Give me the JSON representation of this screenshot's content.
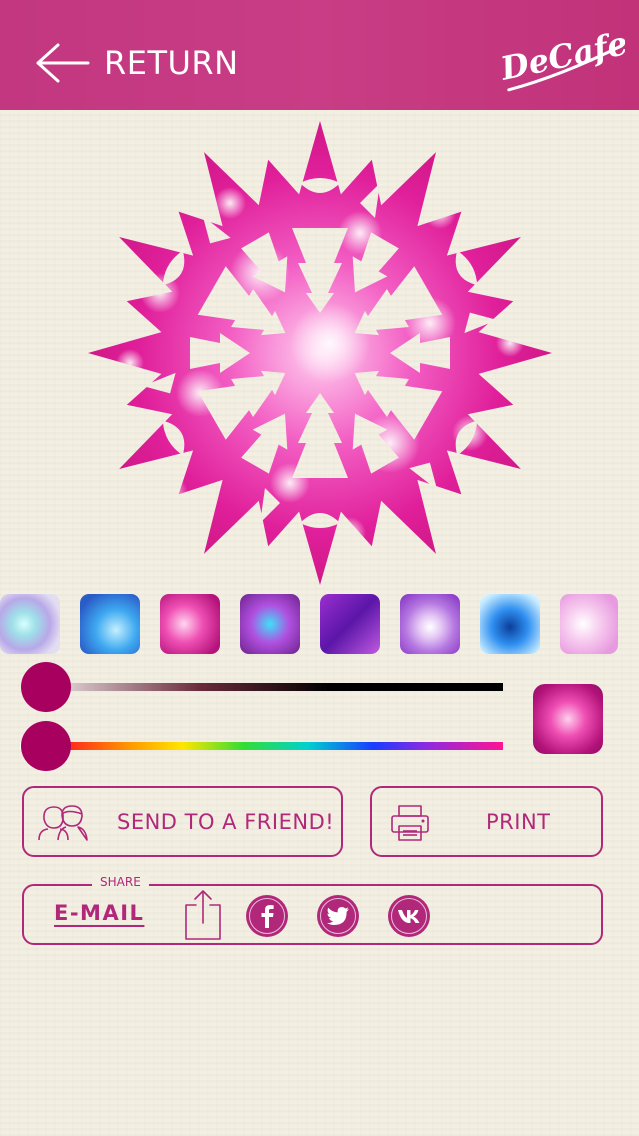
{
  "header": {
    "return_label": "RETURN",
    "logo_text": "DeCafe",
    "background_color": "#c2377f"
  },
  "colors": {
    "accent": "#b1287a",
    "slider_knob": "#a8005f",
    "background": "#f3efe2"
  },
  "swatches": [
    {
      "name": "teal-glow",
      "selected": false
    },
    {
      "name": "blue-sparkle",
      "selected": false
    },
    {
      "name": "pink-sparkle",
      "selected": true
    },
    {
      "name": "purple-mosaic",
      "selected": false
    },
    {
      "name": "violet-crystal",
      "selected": false
    },
    {
      "name": "lavender-swirl",
      "selected": false
    },
    {
      "name": "blue-petals",
      "selected": false
    },
    {
      "name": "pale-pink",
      "selected": false
    }
  ],
  "sliders": {
    "brightness_value": 0,
    "hue_value": 0
  },
  "actions": {
    "send_label": "SEND TO A FRIEND!",
    "print_label": "PRINT"
  },
  "share": {
    "title": "SHARE",
    "email_label": "E-MAIL",
    "upload_icon": "upload-icon",
    "networks": [
      "facebook-icon",
      "twitter-icon",
      "vk-icon"
    ]
  }
}
